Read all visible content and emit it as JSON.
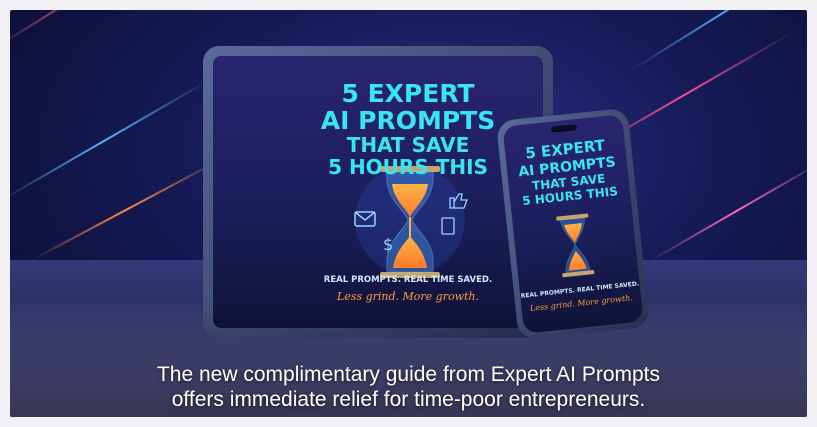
{
  "tablet_screen": {
    "title_lines": [
      "5 EXPERT",
      "AI PROMPTS",
      "THAT SAVE",
      "5 HOURS THIS"
    ],
    "tagline": "REAL PROMPTS. REAL TIME SAVED.",
    "subtagline": "Less grind. More growth."
  },
  "phone_screen": {
    "title_lines": [
      "5 EXPERT",
      "AI PROMPTS",
      "THAT SAVE",
      "5 HOURS THIS"
    ],
    "tagline": "REAL PROMPTS. REAL TIME SAVED.",
    "subtagline": "Less grind. More growth."
  },
  "caption": {
    "line1": "The new complimentary guide from Expert AI Prompts",
    "line2": "offers immediate relief for time-poor entrepreneurs."
  },
  "colors": {
    "title_text": "#38e6f2",
    "accent_orange": "#ff9a3c",
    "screen_bg": "#1a1f5a"
  },
  "icons": [
    "envelope-icon",
    "dollar-icon",
    "thumbs-up-icon",
    "document-icon",
    "hourglass-icon"
  ]
}
